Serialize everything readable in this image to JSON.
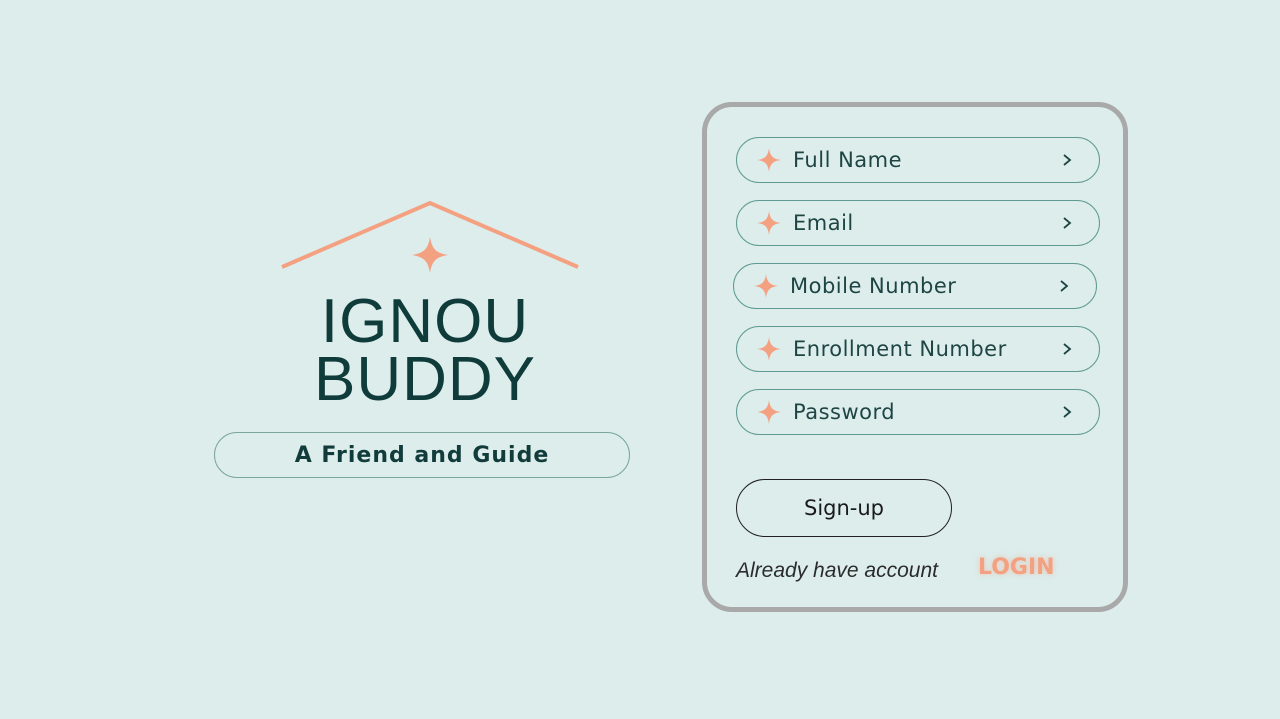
{
  "brand": {
    "title_line1": "IGNOU",
    "title_line2": "BUDDY",
    "tagline": "A Friend and Guide"
  },
  "form": {
    "fields": [
      {
        "label": "Full Name",
        "icon": "sparkle-icon"
      },
      {
        "label": "Email",
        "icon": "sparkle-icon"
      },
      {
        "label": "Mobile Number",
        "icon": "sparkle-icon"
      },
      {
        "label": "Enrollment Number",
        "icon": "sparkle-icon"
      },
      {
        "label": "Password",
        "icon": "sparkle-icon"
      }
    ],
    "signup_label": "Sign-up",
    "already_text": "Already have account",
    "login_label": "LOGIN"
  },
  "colors": {
    "background": "#dcedec",
    "accent": "#f4a182",
    "brand_text": "#0f3b3a",
    "card_border": "#a9a9a9"
  }
}
